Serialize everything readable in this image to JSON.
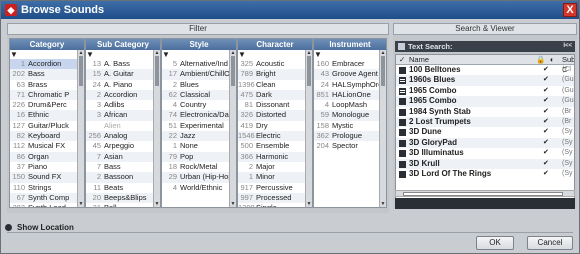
{
  "window": {
    "title": "Browse Sounds",
    "close_glyph": "X"
  },
  "panels": {
    "filter": "Filter",
    "search_viewer": "Search & Viewer"
  },
  "columns": [
    {
      "header": "Category",
      "rows": [
        {
          "n": "1",
          "t": "Accordion",
          "sel": true
        },
        {
          "n": "202",
          "t": "Bass"
        },
        {
          "n": "63",
          "t": "Brass"
        },
        {
          "n": "71",
          "t": "Chromatic P"
        },
        {
          "n": "226",
          "t": "Drum&Perc"
        },
        {
          "n": "16",
          "t": "Ethnic"
        },
        {
          "n": "127",
          "t": "Guitar/Pluck"
        },
        {
          "n": "82",
          "t": "Keyboard"
        },
        {
          "n": "112",
          "t": "Musical FX"
        },
        {
          "n": "86",
          "t": "Organ"
        },
        {
          "n": "37",
          "t": "Piano"
        },
        {
          "n": "150",
          "t": "Sound FX"
        },
        {
          "n": "110",
          "t": "Strings"
        },
        {
          "n": "67",
          "t": "Synth Comp"
        },
        {
          "n": "283",
          "t": "Synth Lead"
        }
      ]
    },
    {
      "header": "Sub Category",
      "rows": [
        {
          "n": "13",
          "t": "A. Bass"
        },
        {
          "n": "15",
          "t": "A. Guitar"
        },
        {
          "n": "24",
          "t": "A. Piano"
        },
        {
          "n": "2",
          "t": "Accordion"
        },
        {
          "n": "3",
          "t": "Adlibs"
        },
        {
          "n": "3",
          "t": "African"
        },
        {
          "n": "",
          "t": "Alien",
          "dim": true
        },
        {
          "n": "256",
          "t": "Analog"
        },
        {
          "n": "45",
          "t": "Arpeggio"
        },
        {
          "n": "7",
          "t": "Asian"
        },
        {
          "n": "7",
          "t": "Bass"
        },
        {
          "n": "2",
          "t": "Bassoon"
        },
        {
          "n": "11",
          "t": "Beats"
        },
        {
          "n": "20",
          "t": "Beeps&Blips"
        },
        {
          "n": "31",
          "t": "Bell"
        }
      ]
    },
    {
      "header": "Style",
      "rows": [
        {
          "n": "5",
          "t": "Alternative/Ind"
        },
        {
          "n": "17",
          "t": "Ambient/ChillO"
        },
        {
          "n": "2",
          "t": "Blues"
        },
        {
          "n": "62",
          "t": "Classical"
        },
        {
          "n": "4",
          "t": "Country"
        },
        {
          "n": "74",
          "t": "Electronica/Da"
        },
        {
          "n": "51",
          "t": "Experimental"
        },
        {
          "n": "22",
          "t": "Jazz"
        },
        {
          "n": "1",
          "t": "None"
        },
        {
          "n": "79",
          "t": "Pop"
        },
        {
          "n": "18",
          "t": "Rock/Metal"
        },
        {
          "n": "29",
          "t": "Urban (Hip-Hop)"
        },
        {
          "n": "4",
          "t": "World/Ethnic"
        }
      ]
    },
    {
      "header": "Character",
      "rows": [
        {
          "n": "325",
          "t": "Acoustic"
        },
        {
          "n": "789",
          "t": "Bright"
        },
        {
          "n": "1396",
          "t": "Clean"
        },
        {
          "n": "475",
          "t": "Dark"
        },
        {
          "n": "81",
          "t": "Dissonant"
        },
        {
          "n": "326",
          "t": "Distorted"
        },
        {
          "n": "419",
          "t": "Dry"
        },
        {
          "n": "1546",
          "t": "Electric"
        },
        {
          "n": "500",
          "t": "Ensemble"
        },
        {
          "n": "366",
          "t": "Harmonic"
        },
        {
          "n": "2",
          "t": "Major"
        },
        {
          "n": "1",
          "t": "Minor"
        },
        {
          "n": "917",
          "t": "Percussive"
        },
        {
          "n": "997",
          "t": "Processed"
        },
        {
          "n": "1209",
          "t": "Single"
        }
      ]
    },
    {
      "header": "Instrument",
      "rows": [
        {
          "n": "160",
          "t": "Embracer"
        },
        {
          "n": "43",
          "t": "Groove Agent"
        },
        {
          "n": "24",
          "t": "HALSymphOrc"
        },
        {
          "n": "851",
          "t": "HALionOne"
        },
        {
          "n": "4",
          "t": "LoopMash"
        },
        {
          "n": "59",
          "t": "Monologue"
        },
        {
          "n": "158",
          "t": "Mystic"
        },
        {
          "n": "362",
          "t": "Prologue"
        },
        {
          "n": "204",
          "t": "Spector"
        }
      ]
    }
  ],
  "search": {
    "label": "Text Search:",
    "nav": "I<<"
  },
  "results": {
    "headers": {
      "name": "Name",
      "sub": "Sub C"
    },
    "rows": [
      {
        "name": "100 Belltones",
        "icon": "preset",
        "check": "✔",
        "sub": "(Cl"
      },
      {
        "name": "1960s Blues",
        "icon": "grid",
        "check": "✔",
        "sub": "(Gu"
      },
      {
        "name": "1965 Combo",
        "icon": "grid",
        "check": "✔",
        "sub": "(Gu"
      },
      {
        "name": "1965 Combo",
        "icon": "preset",
        "check": "✔",
        "sub": "(Gu"
      },
      {
        "name": "1984 Synth Stab",
        "icon": "preset",
        "check": "✔",
        "sub": "(Br"
      },
      {
        "name": "2 Lost Trumpets",
        "icon": "preset",
        "check": "✔",
        "sub": "(Br"
      },
      {
        "name": "3D Dune",
        "icon": "preset",
        "check": "✔",
        "sub": "(Sy"
      },
      {
        "name": "3D GloryPad",
        "icon": "preset",
        "check": "✔",
        "sub": "(Sy"
      },
      {
        "name": "3D Illuminatus",
        "icon": "preset",
        "check": "✔",
        "sub": "(Sy"
      },
      {
        "name": "3D Krull",
        "icon": "preset",
        "check": "✔",
        "sub": "(Sy"
      },
      {
        "name": "3D Lord Of The Rings",
        "icon": "preset",
        "check": "✔",
        "sub": "(Sy"
      }
    ]
  },
  "footer": {
    "show_location": "Show Location",
    "ok": "OK",
    "cancel": "Cancel"
  }
}
